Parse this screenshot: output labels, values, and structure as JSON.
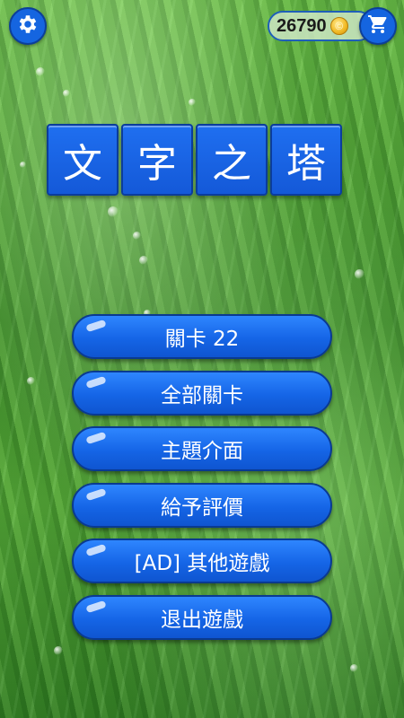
{
  "header": {
    "settings_icon": "gear-icon",
    "coins": "26790",
    "coin_symbol": "©",
    "shop_icon": "cart-icon"
  },
  "title": {
    "chars": [
      "文",
      "字",
      "之",
      "塔"
    ]
  },
  "menu": {
    "items": [
      {
        "label": "關卡 22"
      },
      {
        "label": "全部關卡"
      },
      {
        "label": "主題介面"
      },
      {
        "label": "給予評價"
      },
      {
        "label": "[AD] 其他遊戲"
      },
      {
        "label": "退出遊戲"
      }
    ]
  },
  "colors": {
    "button_blue": "#1565e6",
    "button_border": "#0a3a90",
    "coin_gold": "#f0b823",
    "background_green": "#4f9a2e"
  }
}
